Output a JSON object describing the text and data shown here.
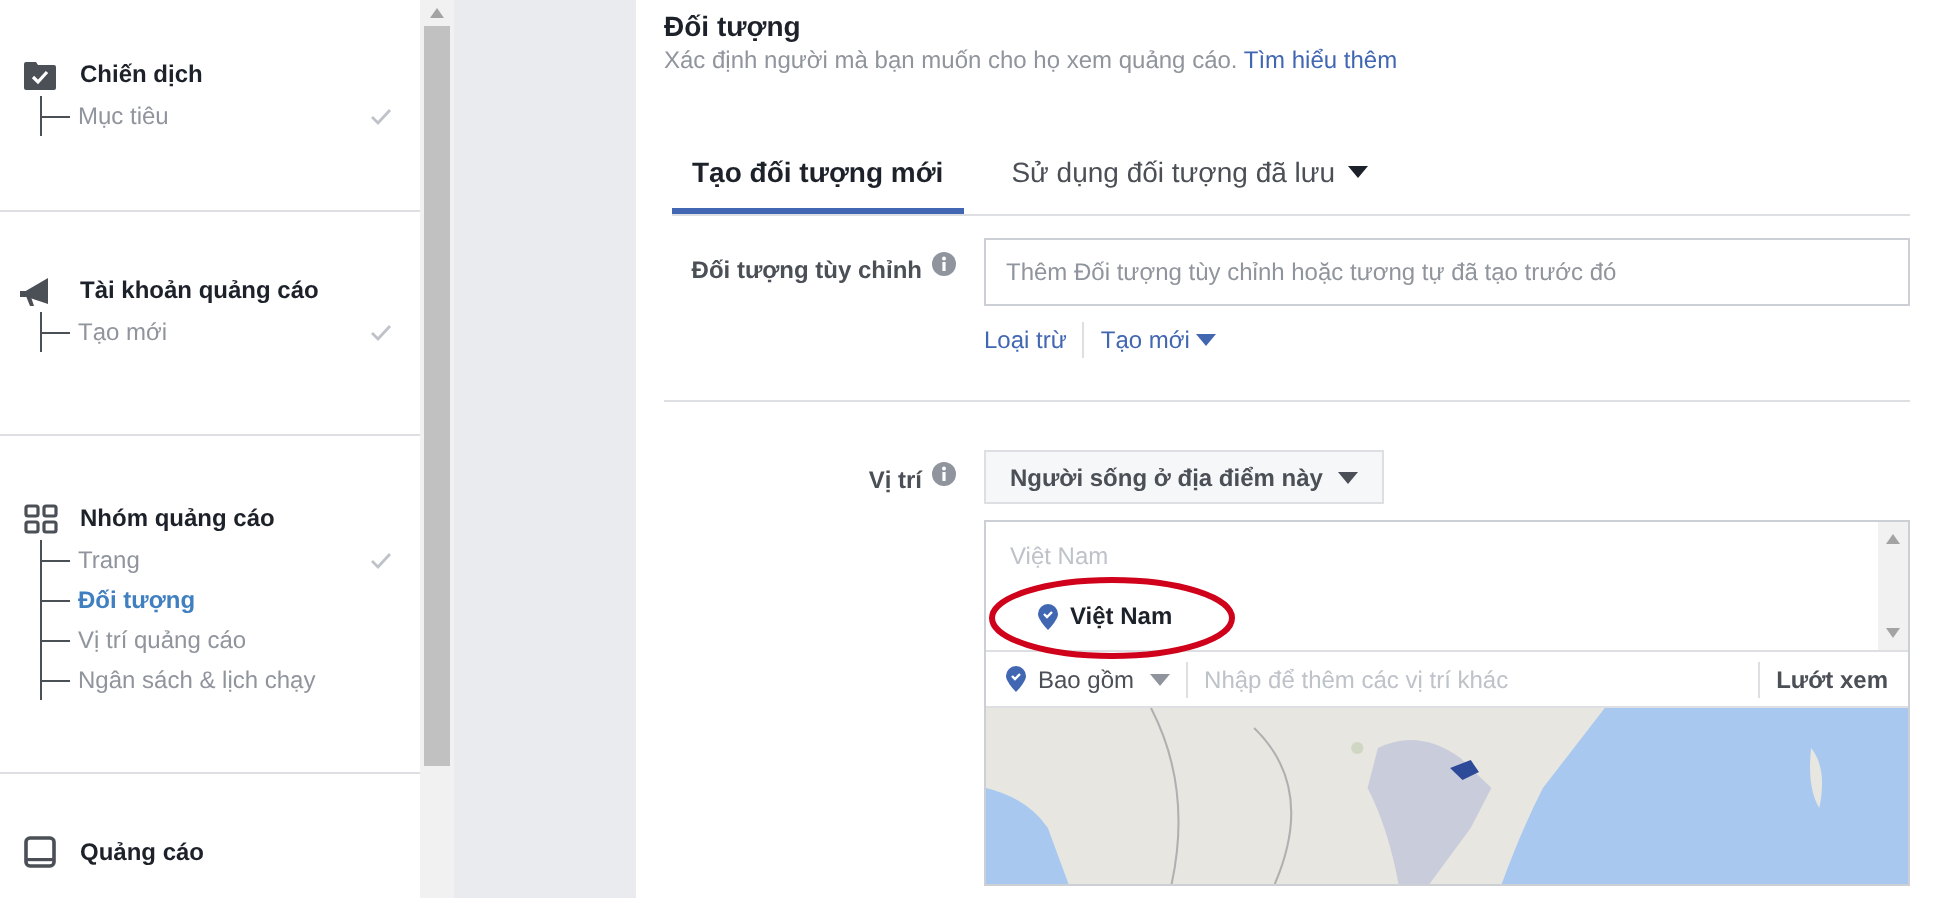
{
  "sidebar": {
    "sections": [
      {
        "kind": "campaign",
        "title": "Chiến dịch",
        "items": [
          {
            "label": "Mục tiêu",
            "done": true,
            "selected": false
          }
        ]
      },
      {
        "kind": "account",
        "title": "Tài khoản quảng cáo",
        "items": [
          {
            "label": "Tạo mới",
            "done": true,
            "selected": false
          }
        ]
      },
      {
        "kind": "adset",
        "title": "Nhóm quảng cáo",
        "items": [
          {
            "label": "Trang",
            "done": true,
            "selected": false
          },
          {
            "label": "Đối tượng",
            "done": false,
            "selected": true
          },
          {
            "label": "Vị trí quảng cáo",
            "done": false,
            "selected": false
          },
          {
            "label": "Ngân sách & lịch chạy",
            "done": false,
            "selected": false
          }
        ]
      },
      {
        "kind": "ad",
        "title": "Quảng cáo"
      }
    ]
  },
  "header": {
    "title": "Đối tượng",
    "subtitle": "Xác định người mà bạn muốn cho họ xem quảng cáo.",
    "link": "Tìm hiểu thêm"
  },
  "tabs": [
    {
      "label": "Tạo đối tượng mới",
      "selected": true,
      "dropdown": false
    },
    {
      "label": "Sử dụng đối tượng đã lưu",
      "selected": false,
      "dropdown": true
    }
  ],
  "custom_audience": {
    "label": "Đối tượng tùy chỉnh",
    "placeholder": "Thêm Đối tượng tùy chỉnh hoặc tương tự đã tạo trước đó",
    "links": [
      "Loại trừ",
      "Tạo mới"
    ]
  },
  "location": {
    "label": "Vị trí",
    "type_button": "Người sống ở địa điểm này",
    "search_text": "Việt Nam",
    "selected_location": "Việt Nam",
    "include": "Bao gồm",
    "placeholder": "Nhập để thêm các vị trí khác",
    "browse": "Lướt xem"
  }
}
